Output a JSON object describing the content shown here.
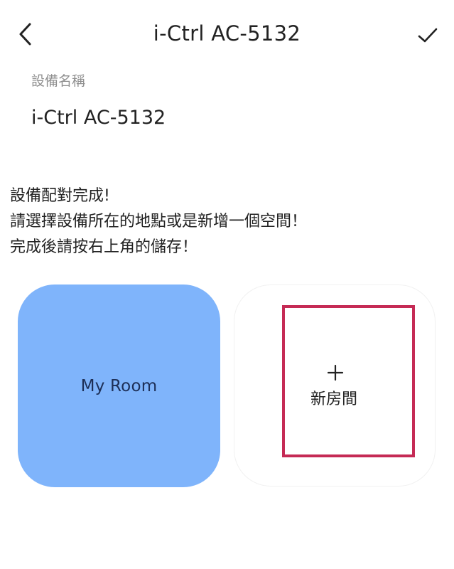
{
  "header": {
    "back_icon": "chevron-left-icon",
    "title": "i-Ctrl AC-5132",
    "save_icon": "checkmark-icon"
  },
  "device_name": {
    "label": "設備名稱",
    "value": "i-Ctrl AC-5132"
  },
  "message": {
    "line1": "設備配對完成!",
    "line2": "請選擇設備所在的地點或是新增一個空間！",
    "line3": "完成後請按右上角的儲存！"
  },
  "rooms": [
    {
      "label": "My Room",
      "color": "#7fb4fb"
    }
  ],
  "add_room": {
    "icon": "plus-icon",
    "label": "新房間",
    "highlight_color": "#c52a55"
  }
}
